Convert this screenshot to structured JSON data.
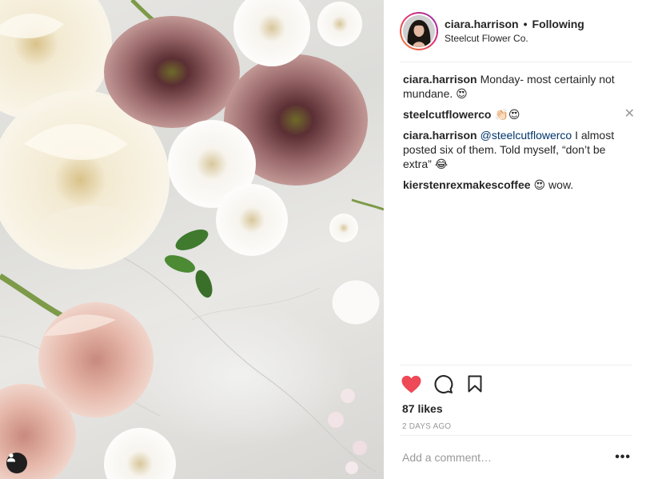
{
  "post": {
    "user": {
      "username": "ciara.harrison",
      "follow_status": "Following",
      "separator": "•",
      "location": "Steelcut Flower Co."
    },
    "comments": [
      {
        "username": "ciara.harrison",
        "text": "Monday- most certainly not mundane.",
        "emoji": "😍"
      },
      {
        "username": "steelcutflowerco",
        "text": "",
        "emoji": "👏🏻😍",
        "has_close": true,
        "close_label": "✕"
      },
      {
        "username": "ciara.harrison",
        "mention": "@steelcutflowerco",
        "text": " I almost posted six of them. Told myself, “don’t be extra”",
        "emoji": "😂"
      },
      {
        "username": "kierstenrexmakescoffee",
        "emoji": "😍",
        "text": " wow."
      }
    ],
    "likes": "87 likes",
    "timestamp": "2 DAYS AGO",
    "liked": true,
    "add_comment_placeholder": "Add a comment…",
    "more_label": "•••"
  },
  "icons": {
    "like": "heart-icon",
    "comment": "comment-bubble-icon",
    "save": "bookmark-icon",
    "user_tag": "user-tag-icon"
  },
  "colors": {
    "liked_heart": "#ed4956",
    "mention": "#003569",
    "muted_text": "#999999",
    "divider": "#efefef"
  }
}
